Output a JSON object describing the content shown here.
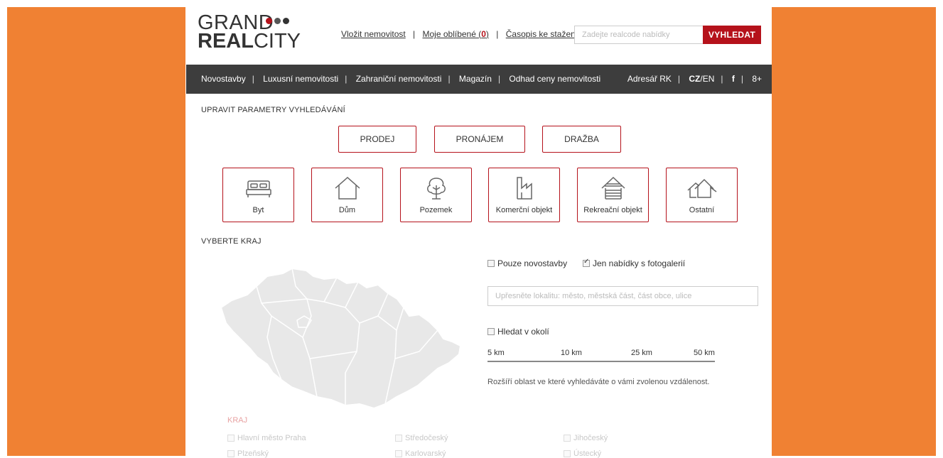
{
  "brand": {
    "line1": "GRAND",
    "line2_bold": "REAL",
    "line2_light": "CITY",
    "accent": "#b5121b",
    "side_color": "#f08133"
  },
  "toplinks": {
    "submit": "Vložit nemovitost",
    "favorites_label": "Moje oblíbené (",
    "favorites_count": "0",
    "favorites_close": ")",
    "magazine": "Časopis ke stažení",
    "separator": "|"
  },
  "search": {
    "placeholder": "Zadejte realcode nabídky",
    "button": "VYHLEDAT"
  },
  "nav": {
    "items": [
      "Novostavby",
      "Luxusní nemovitosti",
      "Zahraniční nemovitosti",
      "Magazín",
      "Odhad ceny nemovitosti"
    ],
    "directory": "Adresář RK",
    "lang_active": "CZ",
    "lang_other": "/EN",
    "facebook": "f",
    "google": "8+"
  },
  "params_title": "UPRAVIT PARAMETRY VYHLEDÁVÁNÍ",
  "transaction": [
    "PRODEJ",
    "PRONÁJEM",
    "DRAŽBA"
  ],
  "categories": [
    {
      "label": "Byt",
      "icon": "bed-icon"
    },
    {
      "label": "Dům",
      "icon": "house-icon"
    },
    {
      "label": "Pozemek",
      "icon": "tree-icon"
    },
    {
      "label": "Komerční objekt",
      "icon": "factory-icon"
    },
    {
      "label": "Rekreační objekt",
      "icon": "cabin-icon"
    },
    {
      "label": "Ostatní",
      "icon": "houses-icon"
    }
  ],
  "region_title": "VYBERTE KRAJ",
  "filters": {
    "new_only": "Pouze novostavby",
    "new_only_checked": false,
    "with_gallery": "Jen nabídky s fotogalerií",
    "with_gallery_checked": true
  },
  "location": {
    "placeholder": "Upřesněte lokalitu: město, městská část, část obce, ulice"
  },
  "nearby": {
    "label": "Hledat v okolí",
    "checked": false,
    "distances": [
      "5 km",
      "10 km",
      "25 km",
      "50 km"
    ],
    "note": "Rozšíří oblast ve které vyhledáváte o vámi zvolenou vzdálenost."
  },
  "kraj": {
    "title": "KRAJ",
    "regions": [
      "Hlavní město Praha",
      "Středočeský",
      "Jihočeský",
      "Plzeňský",
      "Karlovarský",
      "Ústecký"
    ]
  }
}
